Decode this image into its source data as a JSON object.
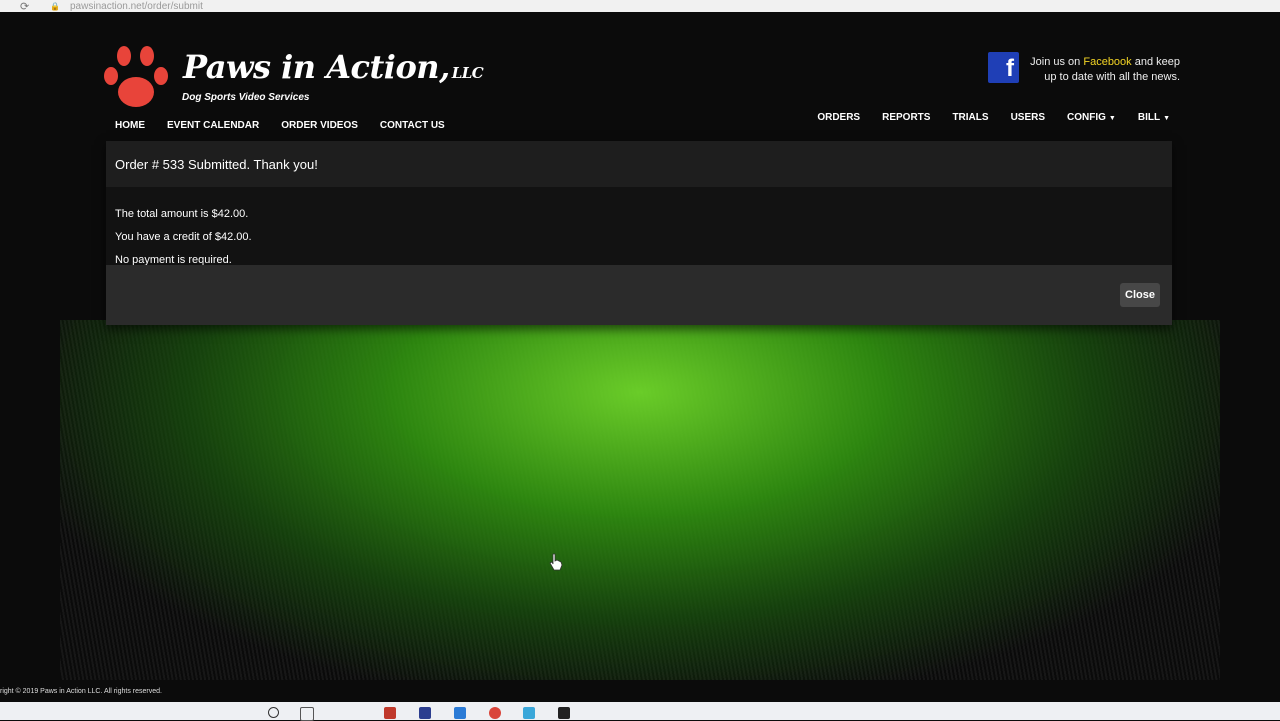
{
  "browser": {
    "url": "pawsinaction.net/order/submit",
    "reload_icon": "reload-icon",
    "lock_icon": "lock-icon"
  },
  "brand": {
    "name": "Paws in Action,",
    "suffix": "LLC",
    "tagline": "Dog Sports Video Services",
    "paw_color": "#e8443a"
  },
  "facebook": {
    "text_before": "Join us on",
    "link": "Facebook",
    "text_after": "and keep up to date with all the news.",
    "icon_color": "#1f3fb6",
    "link_color": "#f3d425"
  },
  "nav": {
    "left": [
      "HOME",
      "EVENT CALENDAR",
      "ORDER VIDEOS",
      "CONTACT US"
    ],
    "right": [
      "ORDERS",
      "REPORTS",
      "TRIALS",
      "USERS",
      "CONFIG",
      "BILL"
    ]
  },
  "modal": {
    "title": "Order # 533 Submitted. Thank you!",
    "lines": [
      "The total amount is $42.00.",
      "You have a credit of $42.00.",
      "No payment is required."
    ],
    "close_label": "Close"
  },
  "footer": {
    "copyright": "right © 2019 Paws in Action LLC. All rights reserved."
  }
}
